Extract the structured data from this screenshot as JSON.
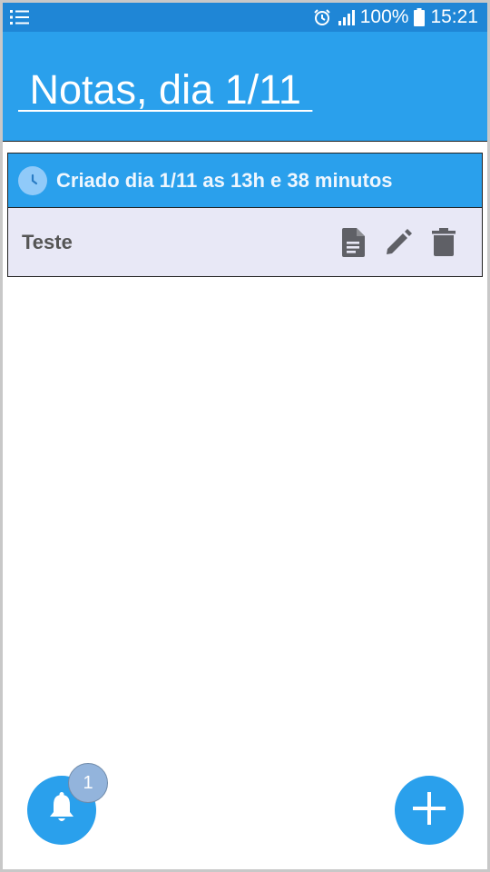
{
  "statusbar": {
    "battery_pct": "100%",
    "time": "15:21"
  },
  "appbar": {
    "title": " Notas, dia 1/11 "
  },
  "note": {
    "created": "Criado dia 1/11 as 13h e 38 minutos",
    "title": "Teste"
  },
  "notifications": {
    "count": "1"
  },
  "colors": {
    "primary": "#2aa0ec",
    "status_bar": "#1f86d6",
    "card_bg": "#e8e8f6",
    "icon_gray": "#5f6066"
  },
  "icons": [
    "menu-icon",
    "alarm-icon",
    "signal-icon",
    "battery-icon",
    "clock-icon",
    "document-icon",
    "edit-icon",
    "delete-icon",
    "bell-icon",
    "plus-icon"
  ]
}
